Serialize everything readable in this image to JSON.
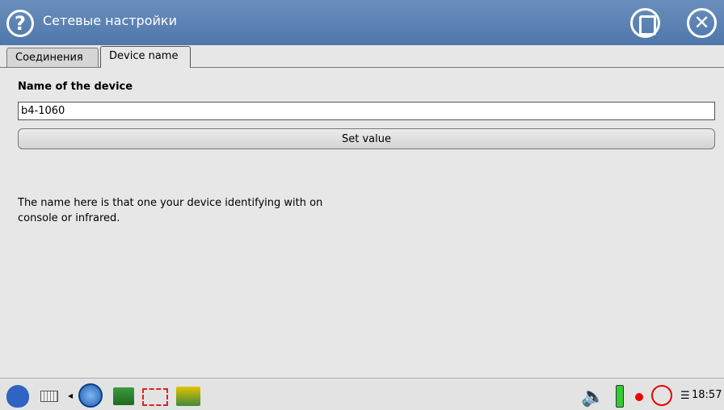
{
  "window": {
    "title": "Сетевые настройки",
    "help_icon": "?",
    "close_icon": "✕",
    "title_bar_color": "#5a80b2"
  },
  "tabs": [
    {
      "label": "Соединения",
      "active": false
    },
    {
      "label": "Device name",
      "active": true
    }
  ],
  "device_name": {
    "label": "Name of the device",
    "value": "b4-1060",
    "set_button": "Set value",
    "help": "The name here is that one your device identifying with on console or infrared."
  },
  "taskbar": {
    "icons": [
      "start-icon",
      "keyboard-icon",
      "globe-icon",
      "network-icon",
      "network-dashed-icon",
      "network-alt-icon",
      "speaker-icon",
      "battery-icon",
      "record-icon",
      "ring-icon"
    ],
    "arrow": "◂",
    "speaker": "🔈",
    "menu_glyph": "☰",
    "clock": "18:57"
  }
}
